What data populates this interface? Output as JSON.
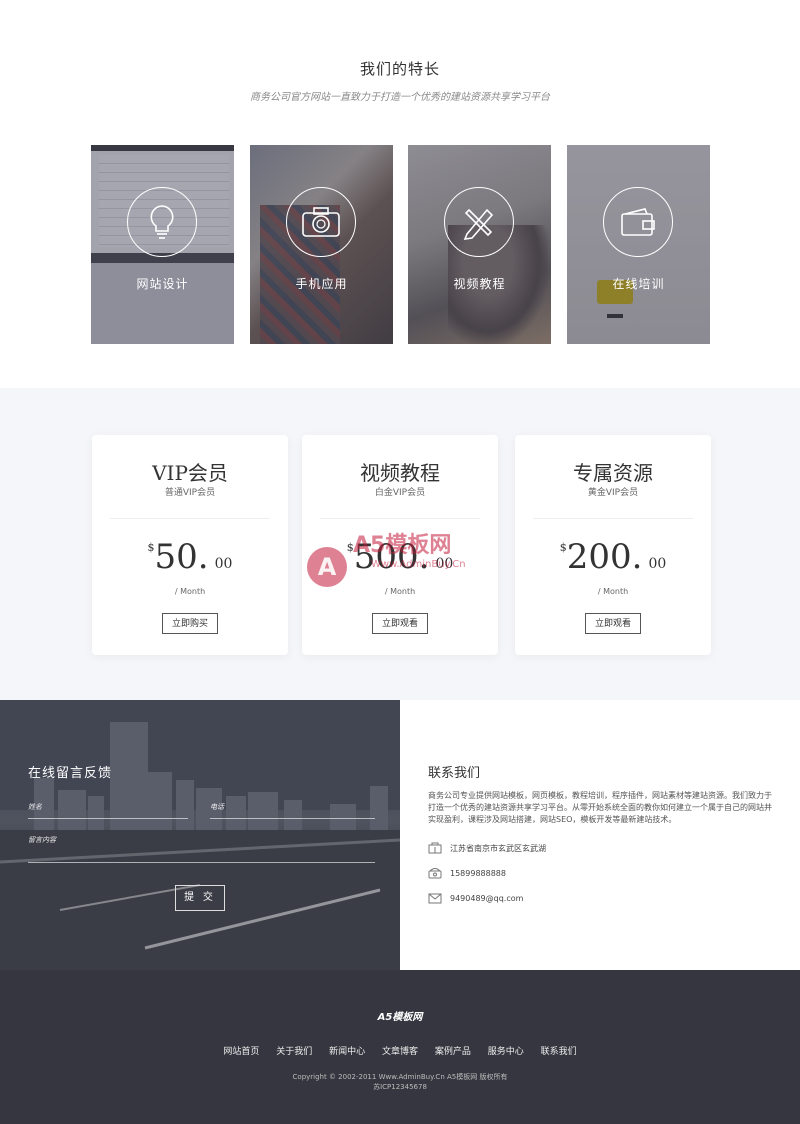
{
  "features": {
    "title": "我们的特长",
    "subtitle": "商务公司官方网站一直致力于打造一个优秀的建站资源共享学习平台",
    "items": [
      {
        "label": "网站设计",
        "icon": "lightbulb-icon"
      },
      {
        "label": "手机应用",
        "icon": "camera-icon"
      },
      {
        "label": "视频教程",
        "icon": "pencil-ruler-icon"
      },
      {
        "label": "在线培训",
        "icon": "wallet-icon"
      }
    ]
  },
  "pricing": {
    "plans": [
      {
        "name": "VIP会员",
        "sub": "普通VIP会员",
        "currency": "$",
        "amount": "50.",
        "cents": "00",
        "per": "/ Month",
        "button": "立即购买"
      },
      {
        "name": "视频教程",
        "sub": "白金VIP会员",
        "currency": "$",
        "amount": "500.",
        "cents": "00",
        "per": "/ Month",
        "button": "立即观看"
      },
      {
        "name": "专属资源",
        "sub": "黄金VIP会员",
        "currency": "$",
        "amount": "200.",
        "cents": "00",
        "per": "/ Month",
        "button": "立即观看"
      }
    ],
    "watermark": {
      "brand": "A5模板网",
      "url": "Www.AdminBuy.Cn"
    }
  },
  "contact_form": {
    "title": "在线留言反馈",
    "name_label": "姓名",
    "phone_label": "电话",
    "message_label": "留言内容",
    "submit": "提 交"
  },
  "contact_info": {
    "title": "联系我们",
    "description": "商务公司专业提供网站模板，网页模板，教程培训，程序插件，网站素材等建站资源。我们致力于打造一个优秀的建站资源共享学习平台。从零开始系统全面的教你如何建立一个属于自己的网站并实现盈利，课程涉及网站搭建，网站SEO，模板开发等最新建站技术。",
    "address": "江苏省南京市玄武区玄武湖",
    "phone": "15899888888",
    "email": "9490489@qq.com"
  },
  "footer": {
    "logo": "A5模板网",
    "nav": [
      "网站首页",
      "关于我们",
      "新闻中心",
      "文章博客",
      "案例产品",
      "服务中心",
      "联系我们"
    ],
    "copyright": "Copyright © 2002-2011 Www.AdminBuy.Cn A5模板网 版权所有",
    "icp": "苏ICP12345678"
  }
}
